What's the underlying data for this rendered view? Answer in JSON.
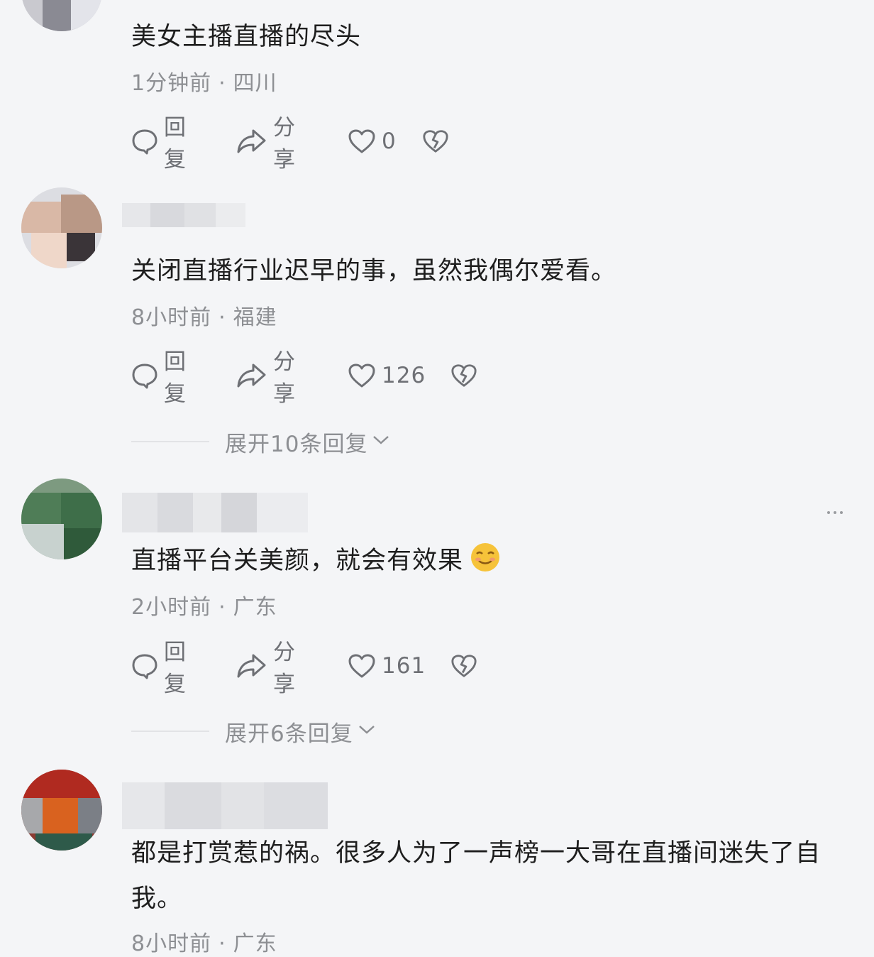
{
  "comments": [
    {
      "text": "美女主播直播的尽头",
      "time": "1分钟前",
      "location": "四川",
      "reply_label": "回复",
      "share_label": "分享",
      "likes": "0"
    },
    {
      "text": "关闭直播行业迟早的事，虽然我偶尔爱看。",
      "time": "8小时前",
      "location": "福建",
      "reply_label": "回复",
      "share_label": "分享",
      "likes": "126",
      "expand_label": "展开10条回复"
    },
    {
      "text": "直播平台关美颜，就会有效果",
      "time": "2小时前",
      "location": "广东",
      "reply_label": "回复",
      "share_label": "分享",
      "likes": "161",
      "expand_label": "展开6条回复"
    },
    {
      "text": "都是打赏惹的祸。很多人为了一声榜一大哥在直播间迷失了自我。",
      "time": "8小时前",
      "location": "广东"
    }
  ],
  "separator": "·",
  "colors": {
    "background": "#f4f5f7",
    "text": "#1e1e1e",
    "meta": "#8d8f93",
    "action": "#6e7075"
  },
  "icons": [
    "comment-icon",
    "share-icon",
    "heart-icon",
    "broken-heart-icon",
    "chevron-down-icon",
    "more-icon",
    "smile-emoji-icon"
  ]
}
